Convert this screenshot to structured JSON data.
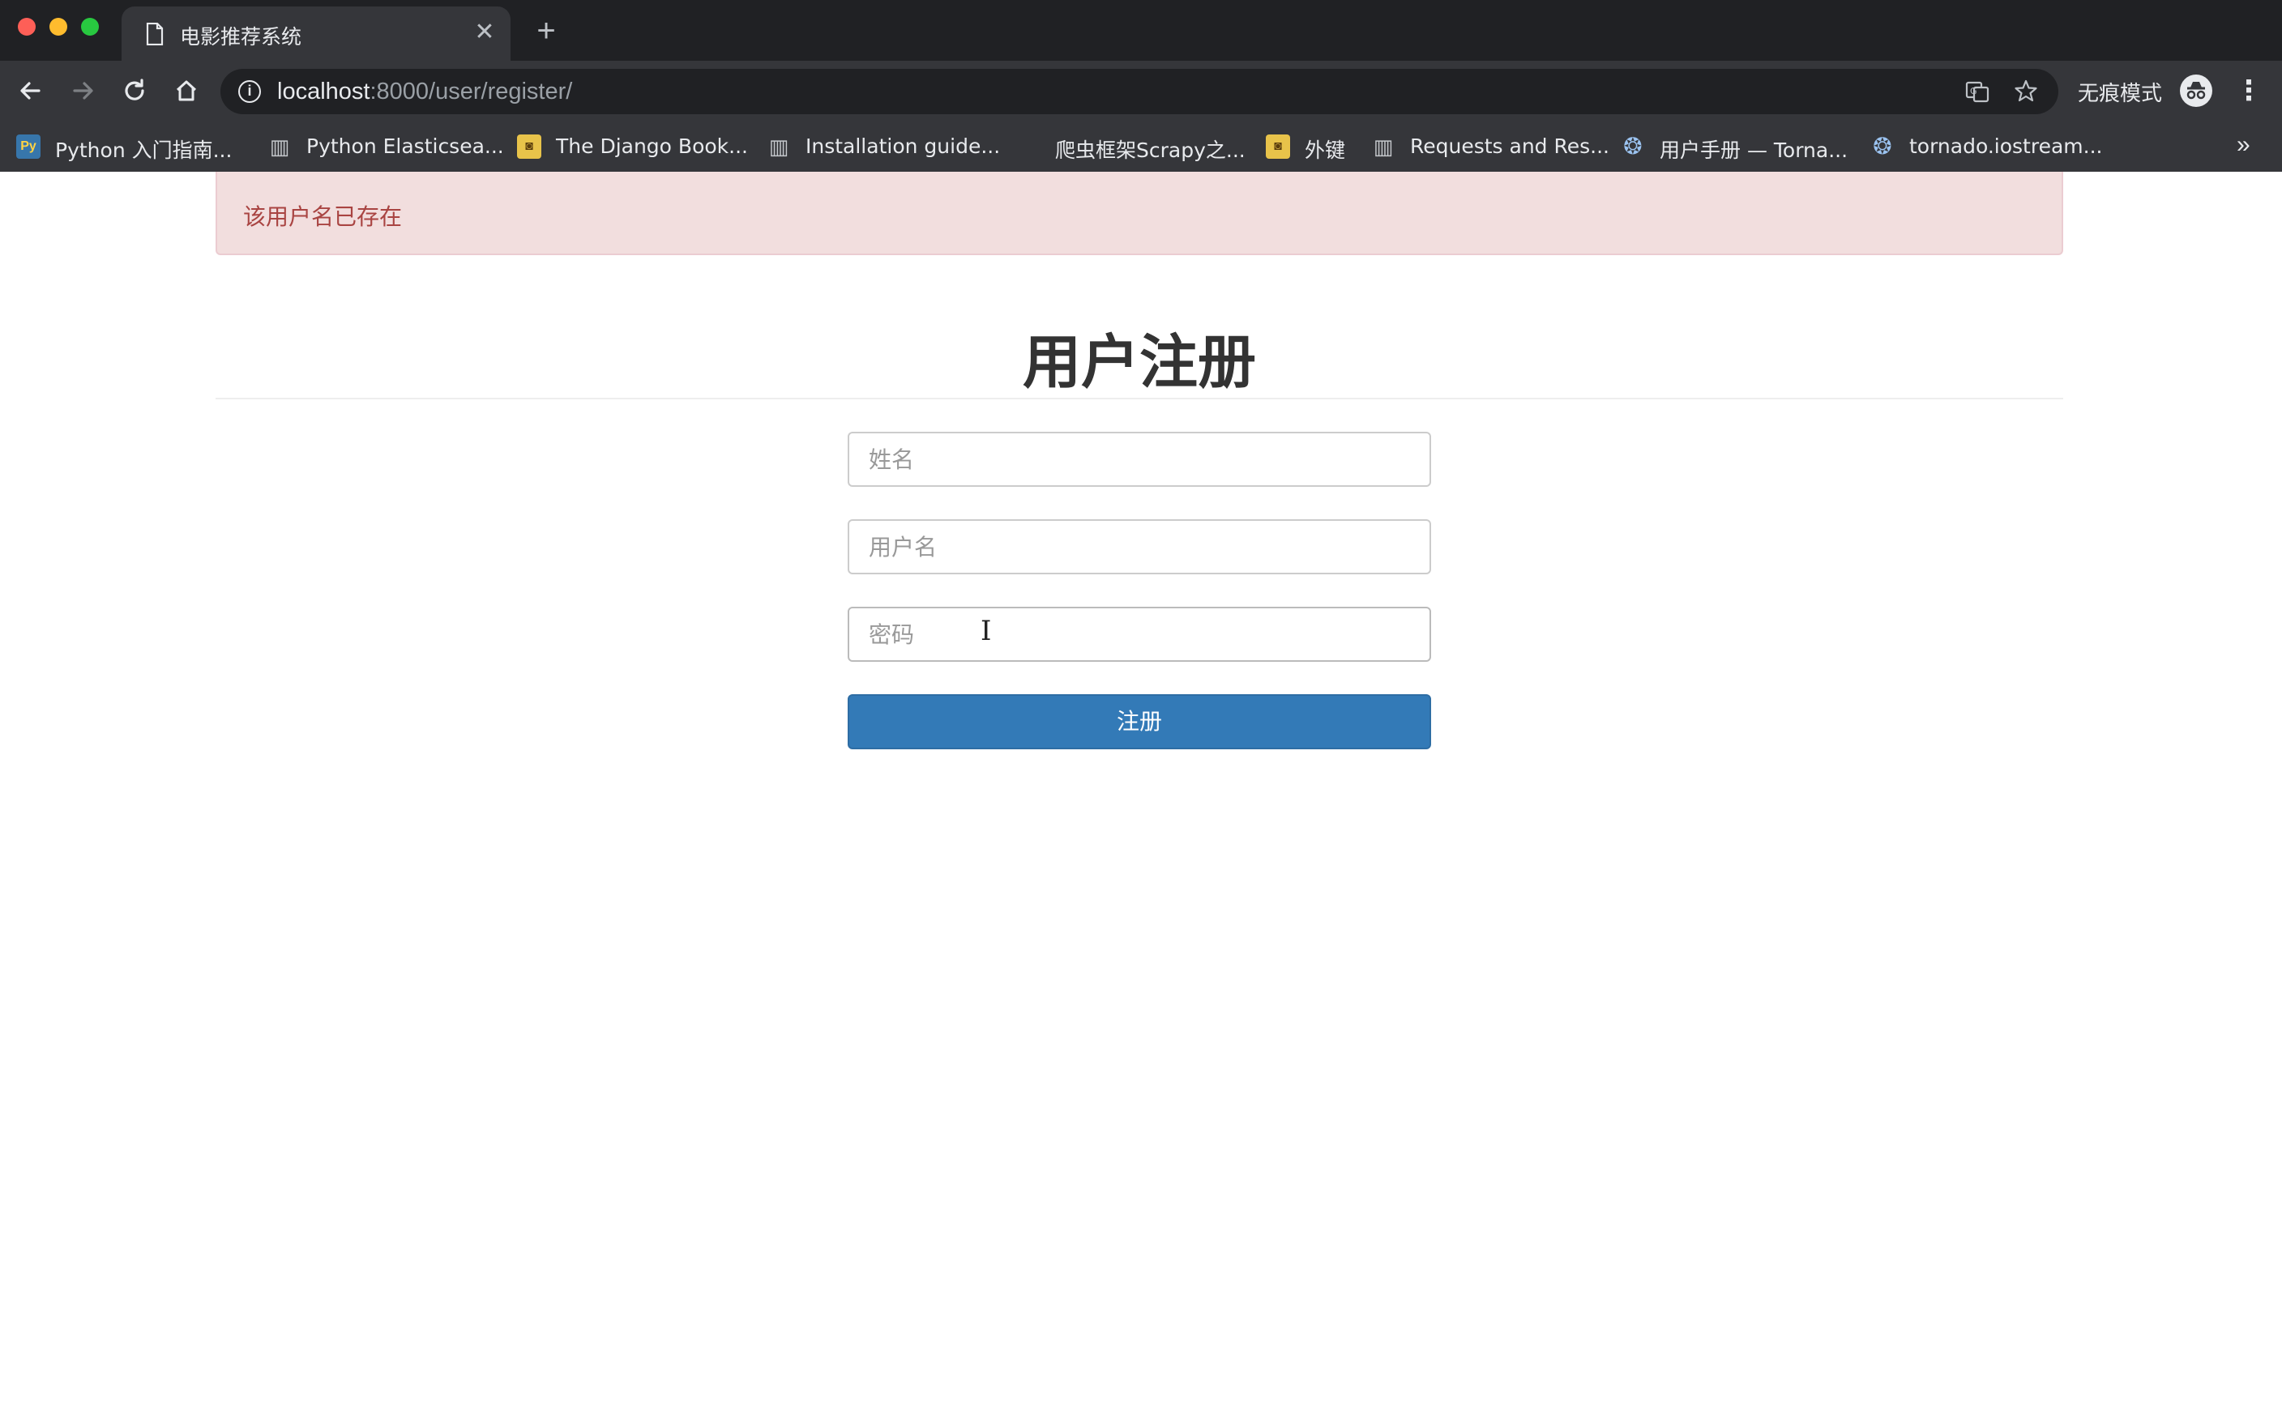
{
  "browser": {
    "tab": {
      "title": "电影推荐系统",
      "icon": "page-icon"
    },
    "address": {
      "host": "localhost",
      "rest": ":8000/user/register/"
    },
    "incognito_label": "无痕模式",
    "bookmarks": [
      {
        "label": "Python 入门指南...",
        "icon": "python-icon"
      },
      {
        "label": "Python Elasticsea...",
        "icon": "doc-icon"
      },
      {
        "label": "The Django Book...",
        "icon": "django-book-icon"
      },
      {
        "label": "Installation guide...",
        "icon": "doc-icon"
      },
      {
        "label": "爬虫框架Scrapy之...",
        "icon": "blank-icon"
      },
      {
        "label": "外键",
        "icon": "django-book-icon"
      },
      {
        "label": "Requests and Res...",
        "icon": "doc-icon"
      },
      {
        "label": "用户手册 — Torna...",
        "icon": "tornado-icon"
      },
      {
        "label": "tornado.iostream...",
        "icon": "tornado-icon"
      }
    ]
  },
  "alert": {
    "message": "该用户名已存在",
    "color": "#a94442",
    "background": "#f2dede"
  },
  "form": {
    "title": "用户注册",
    "fields": {
      "name_placeholder": "姓名",
      "username_placeholder": "用户名",
      "password_placeholder": "密码"
    },
    "submit_label": "注册",
    "submit_color": "#337ab7"
  }
}
